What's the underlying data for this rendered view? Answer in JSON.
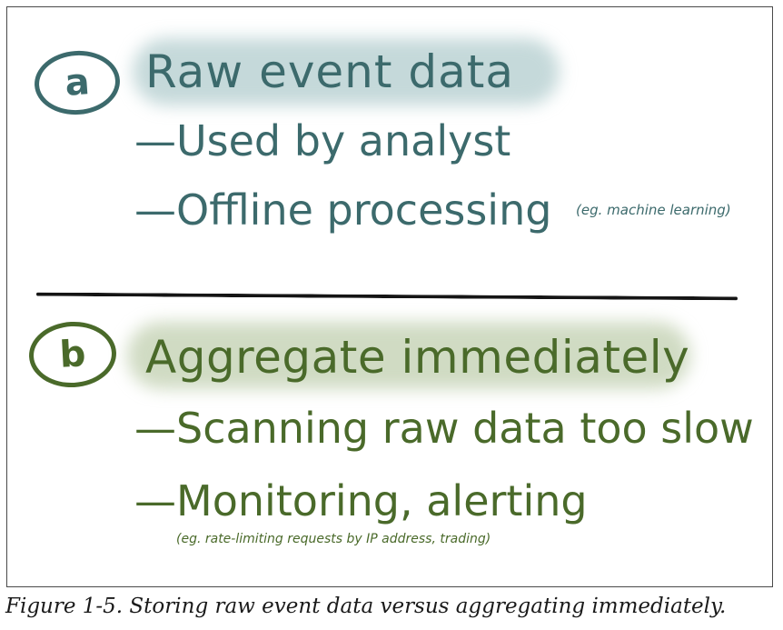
{
  "section_a": {
    "badge": "a",
    "heading": "Raw event data",
    "bullets": [
      "—Used by analyst",
      "—Offline processing"
    ],
    "note": "(eg. machine learning)"
  },
  "section_b": {
    "badge": "b",
    "heading": "Aggregate immediately",
    "bullets": [
      "—Scanning raw data too slow",
      "—Monitoring, alerting"
    ],
    "note": "(eg. rate-limiting requests by IP address, trading)"
  },
  "caption": "Figure 1-5. Storing raw event data versus aggregating immediately.",
  "colors": {
    "section_a": "#3c6a6c",
    "section_b": "#4a6a2a",
    "divider": "#151515"
  }
}
